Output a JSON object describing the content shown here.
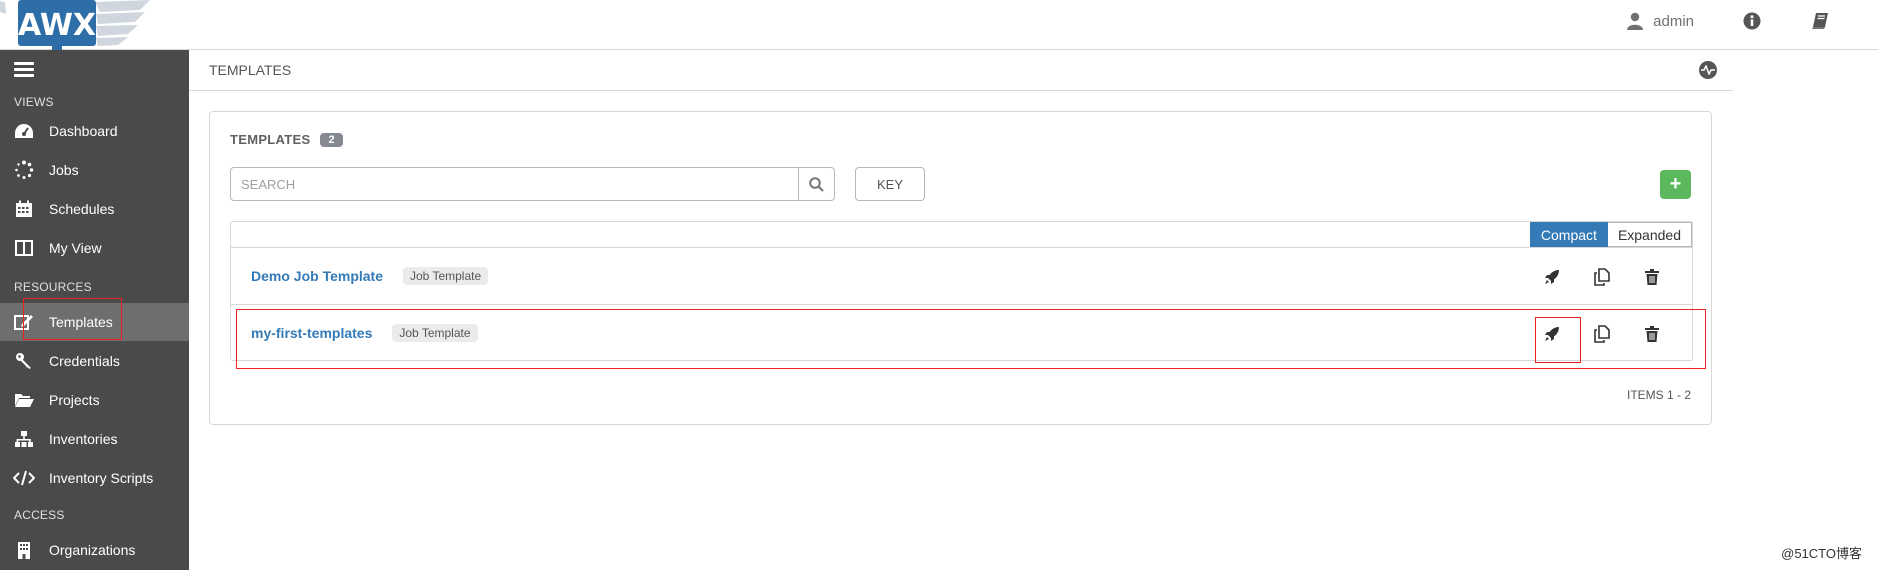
{
  "app": {
    "logo_text": "AWX",
    "user": "admin"
  },
  "sidebar": {
    "sections": {
      "views": "VIEWS",
      "resources": "RESOURCES",
      "access": "ACCESS"
    },
    "items": [
      {
        "label": "Dashboard",
        "icon": "dashboard-icon"
      },
      {
        "label": "Jobs",
        "icon": "spinner-icon"
      },
      {
        "label": "Schedules",
        "icon": "calendar-icon"
      },
      {
        "label": "My View",
        "icon": "columns-icon"
      },
      {
        "label": "Templates",
        "icon": "edit-icon",
        "active": true
      },
      {
        "label": "Credentials",
        "icon": "key-icon"
      },
      {
        "label": "Projects",
        "icon": "folder-icon"
      },
      {
        "label": "Inventories",
        "icon": "sitemap-icon"
      },
      {
        "label": "Inventory Scripts",
        "icon": "code-icon"
      },
      {
        "label": "Organizations",
        "icon": "building-icon"
      }
    ]
  },
  "header": {
    "title": "TEMPLATES"
  },
  "panel": {
    "title": "TEMPLATES",
    "count": "2",
    "search_placeholder": "SEARCH",
    "key_label": "KEY",
    "add_label": "+",
    "view_toggle": {
      "compact": "Compact",
      "expanded": "Expanded"
    },
    "rows": [
      {
        "name": "Demo Job Template",
        "type": "Job Template"
      },
      {
        "name": "my-first-templates",
        "type": "Job Template"
      }
    ],
    "items_label": "ITEMS  1 - 2"
  },
  "watermark": "@51CTO博客",
  "colors": {
    "sidebar_bg": "#4a4a4a",
    "link_blue": "#337ab7",
    "add_green": "#5cb85c",
    "highlight_red": "#e22"
  }
}
